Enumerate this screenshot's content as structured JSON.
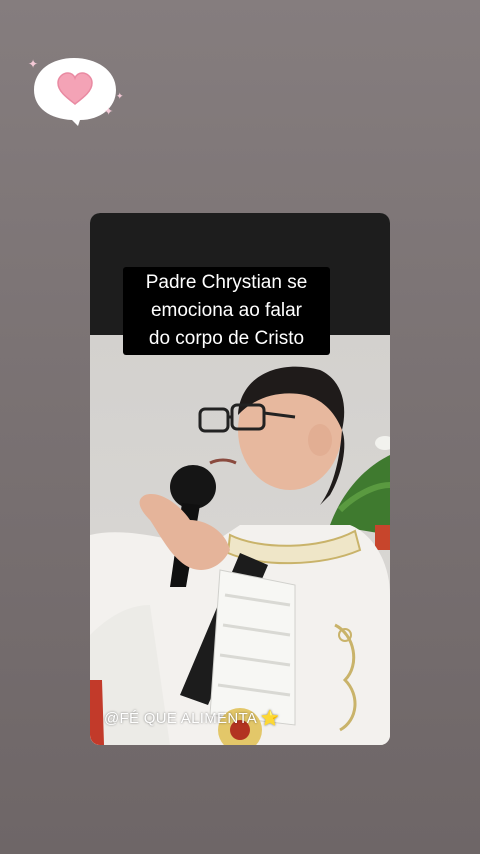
{
  "story": {
    "caption_lines": [
      "Padre Chrystian se",
      "emociona ao falar",
      "do corpo de Cristo"
    ],
    "watermark": "@FÉ QUE ALIMENTA",
    "watermark_emoji": "⭐"
  },
  "sticker": {
    "icon": "heart-speech-bubble-icon",
    "heart_color": "#f4a3b6"
  },
  "colors": {
    "background": "#7a7273",
    "caption_bg": "#000000",
    "caption_text": "#ffffff",
    "card_top": "#1d1d1d"
  }
}
